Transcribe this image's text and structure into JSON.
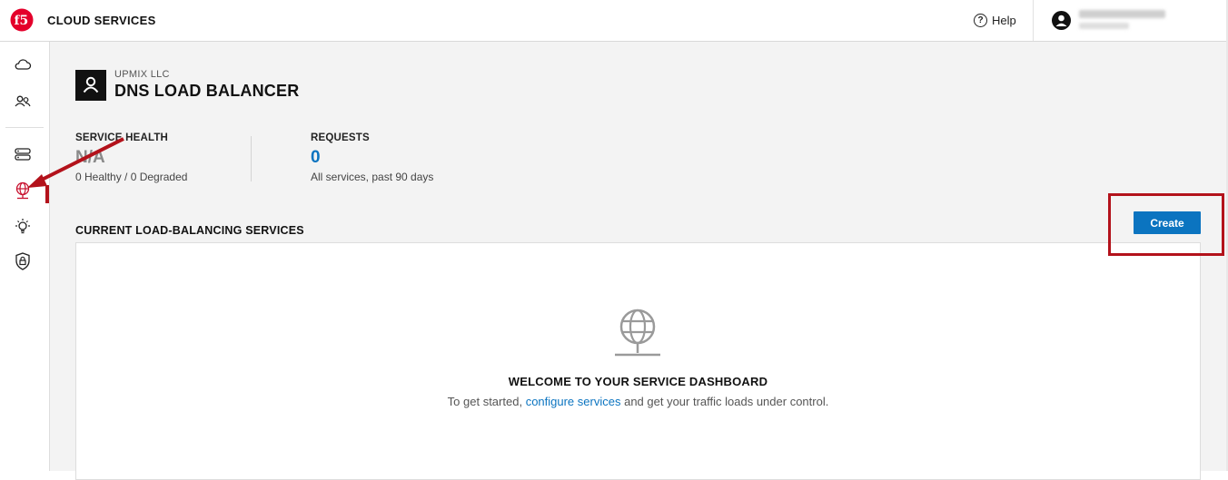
{
  "header": {
    "app_title": "CLOUD SERVICES",
    "help_label": "Help",
    "user_name": "",
    "user_org": ""
  },
  "sidebar": {
    "items": [
      {
        "icon": "cloud-icon"
      },
      {
        "icon": "users-icon"
      },
      {
        "icon": "server-icon"
      },
      {
        "icon": "globe-icon",
        "active": true
      },
      {
        "icon": "bulb-icon"
      },
      {
        "icon": "shield-lock-icon"
      }
    ]
  },
  "page": {
    "org": "UPMIX LLC",
    "title": "DNS LOAD BALANCER"
  },
  "stats": {
    "health_label": "SERVICE HEALTH",
    "health_value": "N/A",
    "health_sub": "0 Healthy / 0 Degraded",
    "requests_label": "REQUESTS",
    "requests_value": "0",
    "requests_sub": "All services, past 90 days"
  },
  "services": {
    "section_title": "CURRENT LOAD-BALANCING SERVICES",
    "create_label": "Create"
  },
  "empty_state": {
    "title": "WELCOME TO YOUR SERVICE DASHBOARD",
    "text_before": "To get started,",
    "link": "configure services",
    "text_after": "and get your traffic loads under control."
  },
  "colors": {
    "accent": "#0b74c0",
    "annotation": "#b3121b",
    "brand": "#e4002b"
  }
}
